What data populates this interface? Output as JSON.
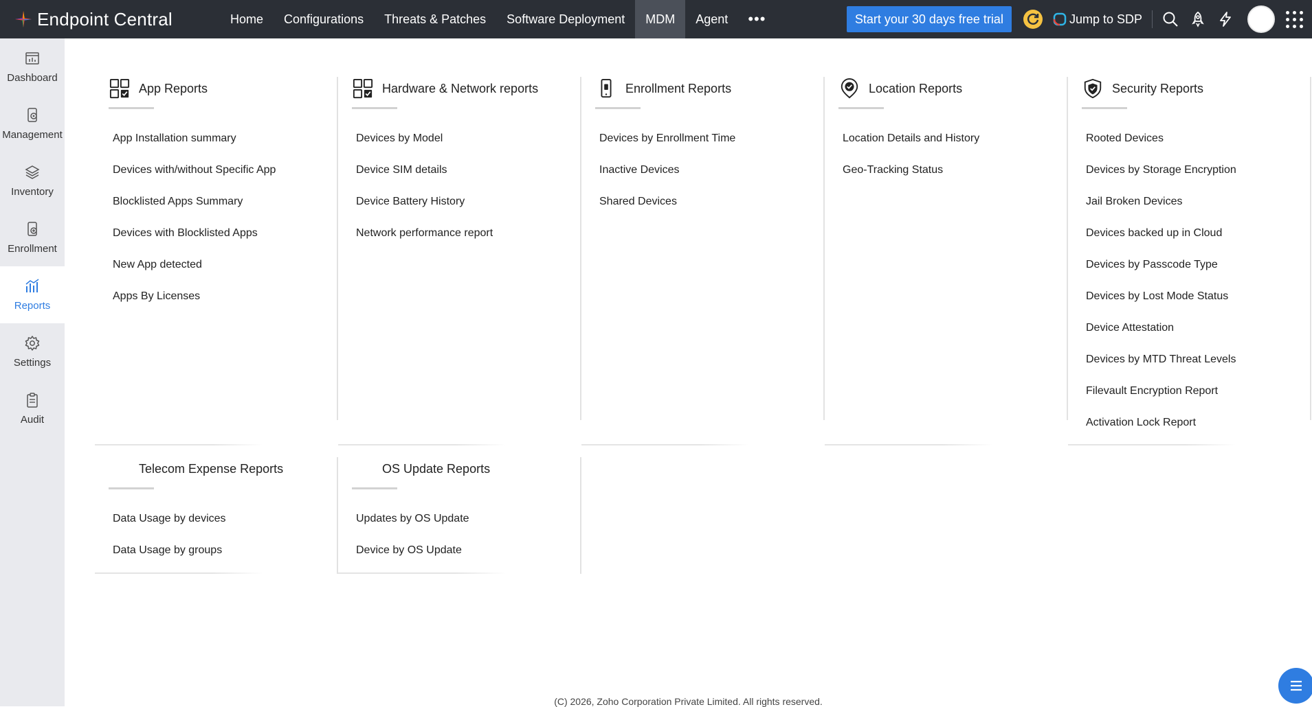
{
  "app": {
    "title": "Endpoint Central"
  },
  "nav": {
    "items": [
      "Home",
      "Configurations",
      "Threats & Patches",
      "Software Deployment",
      "MDM",
      "Agent"
    ],
    "active": "MDM",
    "more_icon": "more-horizontal-icon"
  },
  "topbar": {
    "trial_label": "Start your 30 days free trial",
    "sdp_label": "Jump to SDP",
    "icons": [
      "refresh-icon",
      "search-icon",
      "rocket-icon",
      "flash-icon",
      "avatar",
      "apps-grid-icon"
    ]
  },
  "sidebar": {
    "items": [
      {
        "label": "Dashboard",
        "icon": "dashboard-icon"
      },
      {
        "label": "Management",
        "icon": "management-icon"
      },
      {
        "label": "Inventory",
        "icon": "inventory-icon"
      },
      {
        "label": "Enrollment",
        "icon": "enrollment-icon"
      },
      {
        "label": "Reports",
        "icon": "reports-icon"
      },
      {
        "label": "Settings",
        "icon": "settings-icon"
      },
      {
        "label": "Audit",
        "icon": "audit-icon"
      }
    ],
    "active": "Reports"
  },
  "sections": {
    "app": {
      "title": "App Reports",
      "links": [
        "App Installation summary",
        "Devices with/without Specific App",
        "Blocklisted Apps Summary",
        "Devices with Blocklisted Apps",
        "New App detected",
        "Apps By Licenses"
      ]
    },
    "hardware": {
      "title": "Hardware & Network reports",
      "links": [
        "Devices by Model",
        "Device SIM details",
        "Device Battery History",
        "Network performance report"
      ]
    },
    "enrollment": {
      "title": "Enrollment Reports",
      "links": [
        "Devices by Enrollment Time",
        "Inactive Devices",
        "Shared Devices"
      ]
    },
    "location": {
      "title": "Location Reports",
      "links": [
        "Location Details and History",
        "Geo-Tracking Status"
      ]
    },
    "security": {
      "title": "Security Reports",
      "links": [
        "Rooted Devices",
        "Devices by Storage Encryption",
        "Jail Broken Devices",
        "Devices backed up in Cloud",
        "Devices by Passcode Type",
        "Devices by Lost Mode Status",
        "Device Attestation",
        "Devices by MTD Threat Levels",
        "Filevault Encryption Report",
        "Activation Lock Report"
      ]
    },
    "telecom": {
      "title": "Telecom Expense Reports",
      "links": [
        "Data Usage by devices",
        "Data Usage by groups"
      ]
    },
    "os_update": {
      "title": "OS Update Reports",
      "links": [
        "Updates by OS Update",
        "Device by OS Update"
      ]
    }
  },
  "footer": {
    "text": "(C) 2026, Zoho Corporation Private Limited. All rights reserved."
  },
  "colors": {
    "topbar": "#2b2f36",
    "accent": "#2f7de1",
    "sidebar": "#e9eaee",
    "active_nav": "#4b5059"
  }
}
